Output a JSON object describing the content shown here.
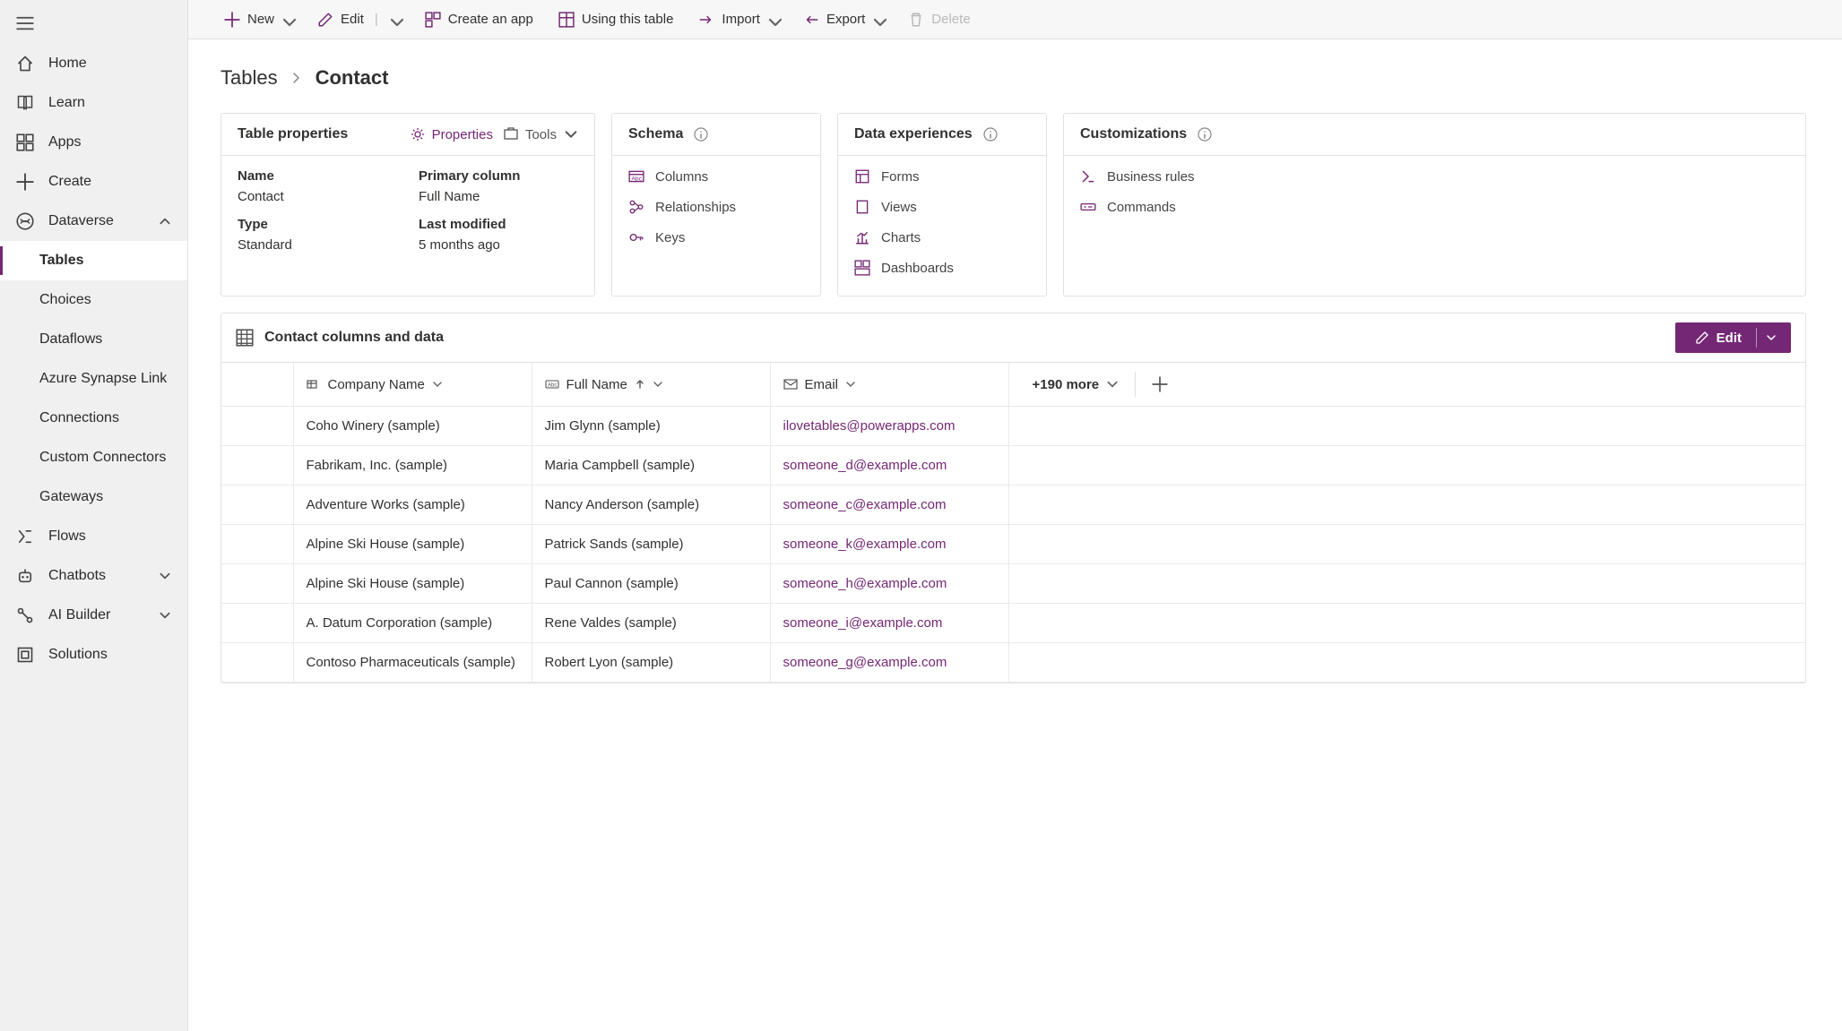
{
  "commandbar": {
    "new": "New",
    "edit": "Edit",
    "create_app": "Create an app",
    "using_table": "Using this table",
    "import": "Import",
    "export": "Export",
    "delete": "Delete"
  },
  "sidebar": {
    "items": [
      {
        "label": "Home"
      },
      {
        "label": "Learn"
      },
      {
        "label": "Apps"
      },
      {
        "label": "Create"
      },
      {
        "label": "Dataverse",
        "expanded": true
      },
      {
        "label": "Tables",
        "sub": true,
        "selected": true
      },
      {
        "label": "Choices",
        "sub": true
      },
      {
        "label": "Dataflows",
        "sub": true
      },
      {
        "label": "Azure Synapse Link",
        "sub": true
      },
      {
        "label": "Connections",
        "sub": true
      },
      {
        "label": "Custom Connectors",
        "sub": true
      },
      {
        "label": "Gateways",
        "sub": true
      },
      {
        "label": "Flows"
      },
      {
        "label": "Chatbots",
        "collapsed": true
      },
      {
        "label": "AI Builder",
        "collapsed": true
      },
      {
        "label": "Solutions"
      }
    ]
  },
  "breadcrumb": {
    "parent": "Tables",
    "current": "Contact"
  },
  "card_props": {
    "title": "Table properties",
    "properties_btn": "Properties",
    "tools_btn": "Tools",
    "name_label": "Name",
    "name_value": "Contact",
    "primary_label": "Primary column",
    "primary_value": "Full Name",
    "type_label": "Type",
    "type_value": "Standard",
    "modified_label": "Last modified",
    "modified_value": "5 months ago"
  },
  "card_schema": {
    "title": "Schema",
    "columns": "Columns",
    "relationships": "Relationships",
    "keys": "Keys"
  },
  "card_experiences": {
    "title": "Data experiences",
    "forms": "Forms",
    "views": "Views",
    "charts": "Charts",
    "dashboards": "Dashboards"
  },
  "card_custom": {
    "title": "Customizations",
    "business_rules": "Business rules",
    "commands": "Commands"
  },
  "data_header": {
    "title": "Contact columns and data",
    "edit": "Edit",
    "more": "+190 more"
  },
  "grid": {
    "columns": {
      "company": "Company Name",
      "fullname": "Full Name",
      "email": "Email"
    },
    "rows": [
      {
        "company": "Coho Winery (sample)",
        "fullname": "Jim Glynn (sample)",
        "email": "ilovetables@powerapps.com"
      },
      {
        "company": "Fabrikam, Inc. (sample)",
        "fullname": "Maria Campbell (sample)",
        "email": "someone_d@example.com"
      },
      {
        "company": "Adventure Works (sample)",
        "fullname": "Nancy Anderson (sample)",
        "email": "someone_c@example.com"
      },
      {
        "company": "Alpine Ski House (sample)",
        "fullname": "Patrick Sands (sample)",
        "email": "someone_k@example.com"
      },
      {
        "company": "Alpine Ski House (sample)",
        "fullname": "Paul Cannon (sample)",
        "email": "someone_h@example.com"
      },
      {
        "company": "A. Datum Corporation (sample)",
        "fullname": "Rene Valdes (sample)",
        "email": "someone_i@example.com"
      },
      {
        "company": "Contoso Pharmaceuticals (sample)",
        "fullname": "Robert Lyon (sample)",
        "email": "someone_g@example.com"
      }
    ]
  }
}
